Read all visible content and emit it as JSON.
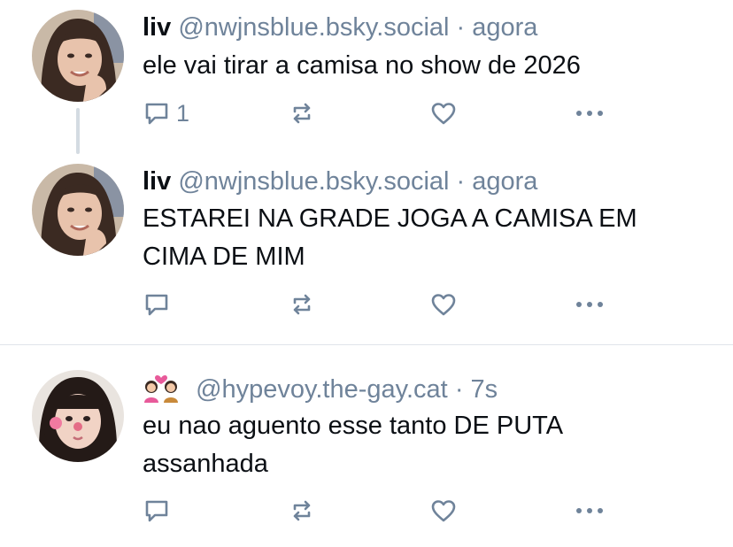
{
  "posts": [
    {
      "display_name": "liv",
      "handle": "@nwjnsblue.bsky.social",
      "separator": "·",
      "time": "agora",
      "text": "ele vai tirar a camisa no show de 2026",
      "reply_count": "1",
      "avatar_icon": "avatar-photo"
    },
    {
      "display_name": "liv",
      "handle": "@nwjnsblue.bsky.social",
      "separator": "·",
      "time": "agora",
      "text": "ESTAREI NA GRADE JOGA A CAMISA EM CIMA DE MIM",
      "reply_count": "",
      "avatar_icon": "avatar-photo"
    },
    {
      "display_name_emoji": "couple-with-heart-emoji",
      "handle": "@hypevoy.the-gay.cat",
      "separator": "·",
      "time": "7s",
      "text": "eu nao aguento esse tanto DE PUTA assanhada",
      "reply_count": "",
      "avatar_icon": "avatar-photo"
    }
  ],
  "icons": {
    "reply": "reply-icon",
    "repost": "repost-icon",
    "like": "heart-icon",
    "more": "more-icon"
  },
  "colors": {
    "text": "#0b0f14",
    "muted": "#6f839a",
    "thread_line": "#d4dbe2",
    "divider": "#dfe4ea"
  }
}
